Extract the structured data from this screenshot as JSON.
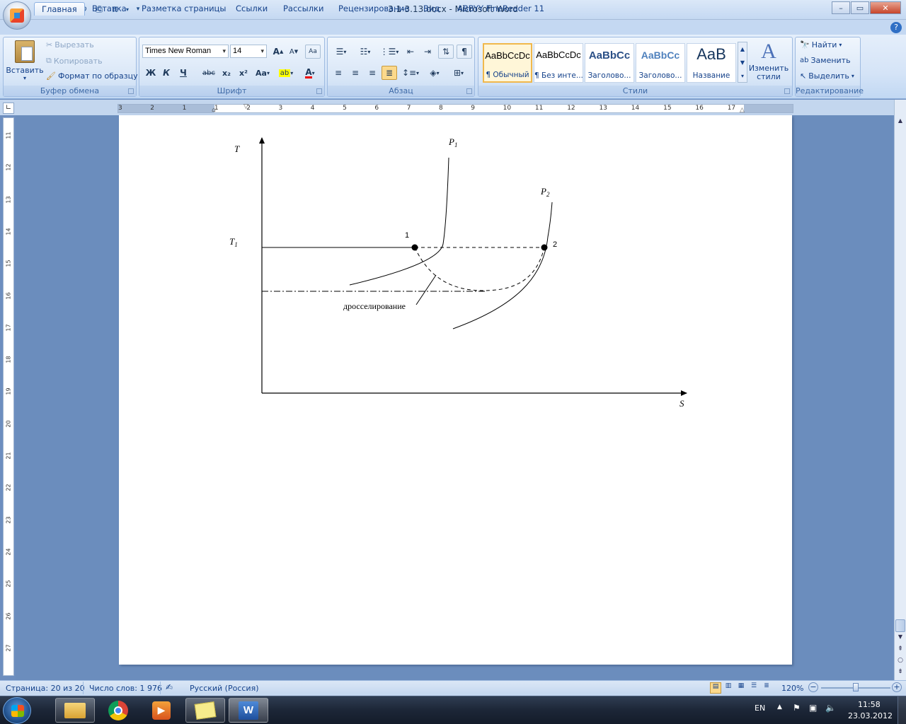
{
  "window": {
    "title": "3.1-3.13.docx - Microsoft Word",
    "minimize": "–",
    "maximize": "▭",
    "close": "✕"
  },
  "tabs": [
    "Главная",
    "Вставка",
    "Разметка страницы",
    "Ссылки",
    "Рассылки",
    "Рецензирование",
    "Вид",
    "ABBYY FineReader 11"
  ],
  "clipboard": {
    "paste": "Вставить",
    "cut": "Вырезать",
    "copy": "Копировать",
    "format_painter": "Формат по образцу",
    "label": "Буфер обмена"
  },
  "font": {
    "family": "Times New Roman",
    "size": "14",
    "label": "Шрифт",
    "bold": "Ж",
    "italic": "К",
    "underline": "Ч",
    "strike": "abc",
    "subscript": "x₂",
    "superscript": "x²",
    "case": "Aa"
  },
  "paragraph": {
    "label": "Абзац"
  },
  "styles": {
    "label": "Стили",
    "items": [
      {
        "preview": "AaBbCcDc",
        "name": "¶ Обычный"
      },
      {
        "preview": "AaBbCcDc",
        "name": "¶ Без инте..."
      },
      {
        "preview": "AaBbCc",
        "name": "Заголово..."
      },
      {
        "preview": "AaBbCc",
        "name": "Заголово..."
      },
      {
        "preview": "AaB",
        "name": "Название"
      }
    ],
    "change": "Изменить стили"
  },
  "editing": {
    "label": "Редактирование",
    "find": "Найти",
    "replace": "Заменить",
    "select": "Выделить"
  },
  "ruler": {
    "hticks": [
      "3",
      "2",
      "1",
      "1",
      "2",
      "3",
      "4",
      "5",
      "6",
      "7",
      "8",
      "9",
      "10",
      "11",
      "12",
      "13",
      "14",
      "15",
      "16",
      "17"
    ],
    "vticks": [
      "11",
      "12",
      "13",
      "14",
      "15",
      "16",
      "17",
      "18",
      "19",
      "20",
      "21",
      "22",
      "23",
      "24",
      "25",
      "26",
      "27"
    ]
  },
  "diagram": {
    "axis_y": "T",
    "axis_x": "S",
    "t1": "T",
    "t1_sub": "1",
    "p1": "P",
    "p1_sub": "1",
    "p2": "P",
    "p2_sub": "2",
    "point1": "1",
    "point2": "2",
    "throttling": "дросселирование"
  },
  "status": {
    "page": "Страница: 20 из 20",
    "words": "Число слов: 1 976",
    "language": "Русский (Россия)",
    "zoom": "120%"
  },
  "taskbar": {
    "lang": "EN",
    "time": "11:58",
    "date": "23.03.2012"
  }
}
